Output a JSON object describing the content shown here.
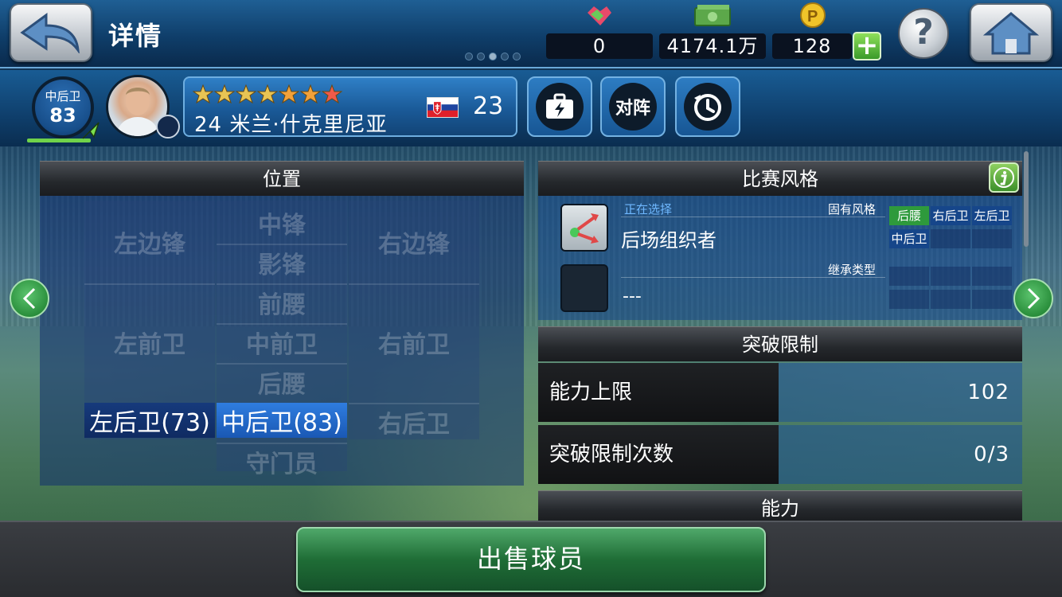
{
  "header": {
    "title": "详情",
    "currencies": [
      {
        "icon": "handshake-icon",
        "value": "0"
      },
      {
        "icon": "money-icon",
        "value": "4174.1万"
      },
      {
        "icon": "coin-icon",
        "value": "128"
      }
    ]
  },
  "player": {
    "position": "中后卫",
    "overall": "83",
    "stars": 7,
    "name": "24 米兰·什克里尼亚",
    "nationality_flag": "slovakia-flag",
    "age": "23",
    "lineup_label": "对阵"
  },
  "positions_panel": {
    "title": "位置",
    "cells": {
      "lwf": "左边锋",
      "cf": "中锋",
      "rwf": "右边锋",
      "ss": "影锋",
      "amf": "前腰",
      "lmf": "左前卫",
      "cmf": "中前卫",
      "rmf": "右前卫",
      "dmf": "后腰",
      "lb": "左后卫(73)",
      "cb": "中后卫(83)",
      "rb": "右后卫",
      "gk": "守门员"
    }
  },
  "style_panel": {
    "title": "比赛风格",
    "selecting_label": "正在选择",
    "current_style": "后场组织者",
    "inherent_label": "固有风格",
    "inherent_tags": [
      "后腰",
      "右后卫",
      "左后卫",
      "中后卫"
    ],
    "inherit_label": "继承类型",
    "inherit_style": "---"
  },
  "limit_panel": {
    "title": "突破限制",
    "rows": [
      {
        "label": "能力上限",
        "value": "102"
      },
      {
        "label": "突破限制次数",
        "value": "0/3"
      }
    ]
  },
  "ability_panel": {
    "title": "能力"
  },
  "footer": {
    "sell_label": "出售球员"
  },
  "colors": {
    "accent_green": "#2a8f3c",
    "active_blue": "#2f7de0",
    "header_blue": "#0f3e6a"
  }
}
